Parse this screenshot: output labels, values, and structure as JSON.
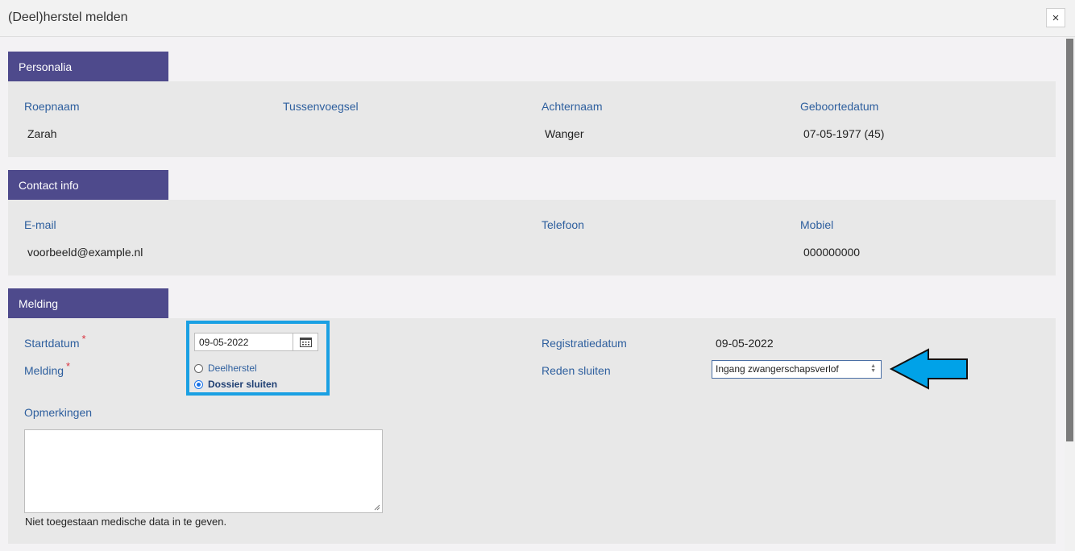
{
  "dialog": {
    "title": "(Deel)herstel melden",
    "close_label": "×"
  },
  "personalia": {
    "header": "Personalia",
    "fields": [
      {
        "label": "Roepnaam",
        "value": "Zarah"
      },
      {
        "label": "Tussenvoegsel",
        "value": ""
      },
      {
        "label": "Achternaam",
        "value": "Wanger"
      },
      {
        "label": "Geboortedatum",
        "value": "07-05-1977 (45)"
      }
    ]
  },
  "contact": {
    "header": "Contact info",
    "fields": [
      {
        "label": "E-mail",
        "value": "voorbeeld@example.nl"
      },
      {
        "label": "Telefoon",
        "value": ""
      },
      {
        "label": "Mobiel",
        "value": "000000000"
      }
    ]
  },
  "melding": {
    "header": "Melding",
    "startdatum": {
      "label": "Startdatum",
      "required_mark": "*",
      "value": "09-05-2022"
    },
    "melding_field": {
      "label": "Melding",
      "required_mark": "*",
      "options": [
        {
          "label": "Deelherstel",
          "selected": false
        },
        {
          "label": "Dossier sluiten",
          "selected": true
        }
      ]
    },
    "registratiedatum": {
      "label": "Registratiedatum",
      "value": "09-05-2022"
    },
    "reden_sluiten": {
      "label": "Reden sluiten",
      "selected": "Ingang zwangerschapsverlof"
    },
    "opmerkingen": {
      "label": "Opmerkingen",
      "value": "",
      "note": "Niet toegestaan medische data in te geven."
    }
  },
  "colors": {
    "section_header": "#4e4a8c",
    "label": "#2e5f9e",
    "highlight": "#1aa0e3",
    "arrow": "#00a2e8"
  },
  "icons": {
    "close": "close-icon",
    "calendar": "calendar-icon",
    "arrow": "arrow-left-icon"
  }
}
